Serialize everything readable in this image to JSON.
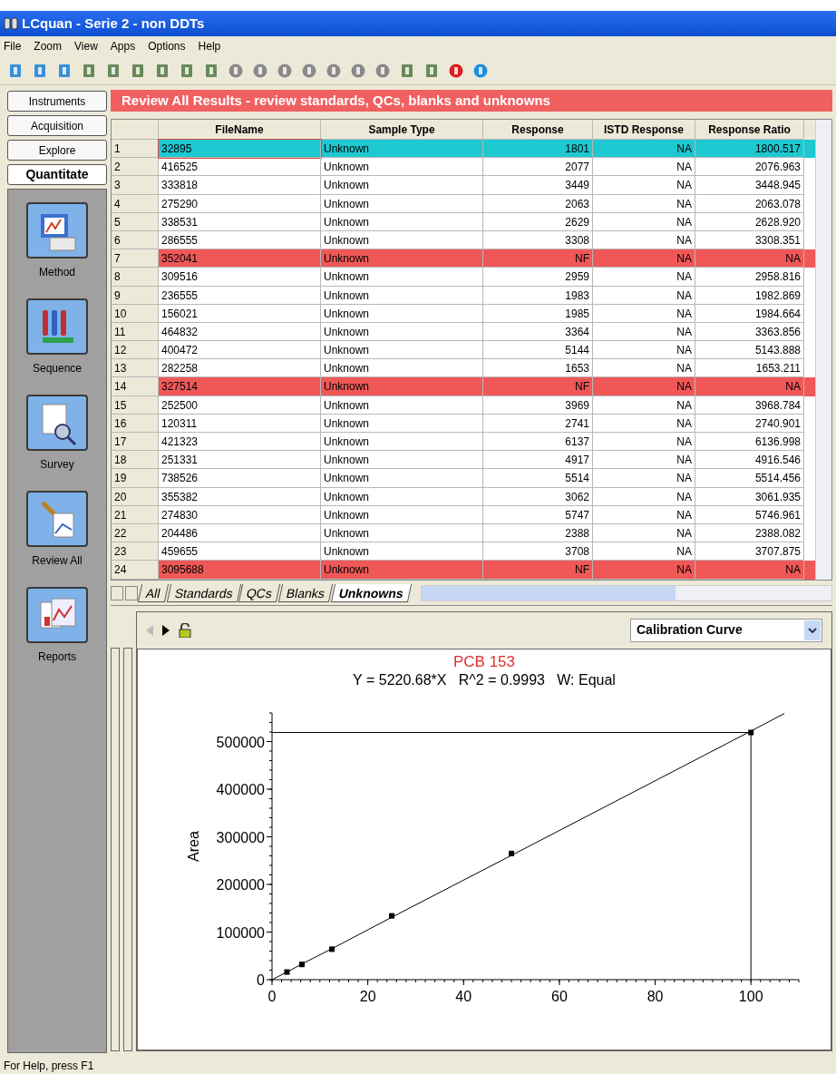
{
  "window": {
    "title": "LCquan - Serie 2 - non DDTs"
  },
  "menu": [
    "File",
    "Zoom",
    "View",
    "Apps",
    "Options",
    "Help"
  ],
  "nav_buttons": [
    {
      "label": "Instruments",
      "selected": false
    },
    {
      "label": "Acquisition",
      "selected": false
    },
    {
      "label": "Explore",
      "selected": false
    },
    {
      "label": "Quantitate",
      "selected": true
    }
  ],
  "sidebar": {
    "items": [
      {
        "label": "Method",
        "kind": "method"
      },
      {
        "label": "Sequence",
        "kind": "sequence"
      },
      {
        "label": "Survey",
        "kind": "survey"
      },
      {
        "label": "Review All",
        "kind": "review"
      },
      {
        "label": "Reports",
        "kind": "reports"
      }
    ]
  },
  "banner": "Review All Results - review standards, QCs, blanks and unknowns",
  "table": {
    "columns": [
      "FileName",
      "Sample Type",
      "Response",
      "ISTD Response",
      "Response Ratio"
    ],
    "rows": [
      {
        "n": "1",
        "file": "32895",
        "type": "Unknown",
        "response": "1801",
        "istd": "NA",
        "ratio": "1800.517",
        "selected": true,
        "flagged": false
      },
      {
        "n": "2",
        "file": "416525",
        "type": "Unknown",
        "response": "2077",
        "istd": "NA",
        "ratio": "2076.963",
        "selected": false,
        "flagged": false
      },
      {
        "n": "3",
        "file": "333818",
        "type": "Unknown",
        "response": "3449",
        "istd": "NA",
        "ratio": "3448.945",
        "selected": false,
        "flagged": false
      },
      {
        "n": "4",
        "file": "275290",
        "type": "Unknown",
        "response": "2063",
        "istd": "NA",
        "ratio": "2063.078",
        "selected": false,
        "flagged": false
      },
      {
        "n": "5",
        "file": "338531",
        "type": "Unknown",
        "response": "2629",
        "istd": "NA",
        "ratio": "2628.920",
        "selected": false,
        "flagged": false
      },
      {
        "n": "6",
        "file": "286555",
        "type": "Unknown",
        "response": "3308",
        "istd": "NA",
        "ratio": "3308.351",
        "selected": false,
        "flagged": false
      },
      {
        "n": "7",
        "file": "352041",
        "type": "Unknown",
        "response": "NF",
        "istd": "NA",
        "ratio": "NA",
        "selected": false,
        "flagged": true
      },
      {
        "n": "8",
        "file": "309516",
        "type": "Unknown",
        "response": "2959",
        "istd": "NA",
        "ratio": "2958.816",
        "selected": false,
        "flagged": false
      },
      {
        "n": "9",
        "file": "236555",
        "type": "Unknown",
        "response": "1983",
        "istd": "NA",
        "ratio": "1982.869",
        "selected": false,
        "flagged": false
      },
      {
        "n": "10",
        "file": "156021",
        "type": "Unknown",
        "response": "1985",
        "istd": "NA",
        "ratio": "1984.664",
        "selected": false,
        "flagged": false
      },
      {
        "n": "11",
        "file": "464832",
        "type": "Unknown",
        "response": "3364",
        "istd": "NA",
        "ratio": "3363.856",
        "selected": false,
        "flagged": false
      },
      {
        "n": "12",
        "file": "400472",
        "type": "Unknown",
        "response": "5144",
        "istd": "NA",
        "ratio": "5143.888",
        "selected": false,
        "flagged": false
      },
      {
        "n": "13",
        "file": "282258",
        "type": "Unknown",
        "response": "1653",
        "istd": "NA",
        "ratio": "1653.211",
        "selected": false,
        "flagged": false
      },
      {
        "n": "14",
        "file": "327514",
        "type": "Unknown",
        "response": "NF",
        "istd": "NA",
        "ratio": "NA",
        "selected": false,
        "flagged": true
      },
      {
        "n": "15",
        "file": "252500",
        "type": "Unknown",
        "response": "3969",
        "istd": "NA",
        "ratio": "3968.784",
        "selected": false,
        "flagged": false
      },
      {
        "n": "16",
        "file": "120311",
        "type": "Unknown",
        "response": "2741",
        "istd": "NA",
        "ratio": "2740.901",
        "selected": false,
        "flagged": false
      },
      {
        "n": "17",
        "file": "421323",
        "type": "Unknown",
        "response": "6137",
        "istd": "NA",
        "ratio": "6136.998",
        "selected": false,
        "flagged": false
      },
      {
        "n": "18",
        "file": "251331",
        "type": "Unknown",
        "response": "4917",
        "istd": "NA",
        "ratio": "4916.546",
        "selected": false,
        "flagged": false
      },
      {
        "n": "19",
        "file": "738526",
        "type": "Unknown",
        "response": "5514",
        "istd": "NA",
        "ratio": "5514.456",
        "selected": false,
        "flagged": false
      },
      {
        "n": "20",
        "file": "355382",
        "type": "Unknown",
        "response": "3062",
        "istd": "NA",
        "ratio": "3061.935",
        "selected": false,
        "flagged": false
      },
      {
        "n": "21",
        "file": "274830",
        "type": "Unknown",
        "response": "5747",
        "istd": "NA",
        "ratio": "5746.961",
        "selected": false,
        "flagged": false
      },
      {
        "n": "22",
        "file": "204486",
        "type": "Unknown",
        "response": "2388",
        "istd": "NA",
        "ratio": "2388.082",
        "selected": false,
        "flagged": false
      },
      {
        "n": "23",
        "file": "459655",
        "type": "Unknown",
        "response": "3708",
        "istd": "NA",
        "ratio": "3707.875",
        "selected": false,
        "flagged": false
      },
      {
        "n": "24",
        "file": "3095688",
        "type": "Unknown",
        "response": "NF",
        "istd": "NA",
        "ratio": "NA",
        "selected": false,
        "flagged": true
      }
    ]
  },
  "sheet_tabs": [
    {
      "label": "All",
      "selected": false
    },
    {
      "label": "Standards",
      "selected": false
    },
    {
      "label": "QCs",
      "selected": false
    },
    {
      "label": "Blanks",
      "selected": false
    },
    {
      "label": "Unknowns",
      "selected": true
    }
  ],
  "chart_panel": {
    "view_select": "Calibration Curve",
    "equation": "Y = 5220.68*X   R^2 = 0.9993   W: Equal",
    "chart_data": {
      "type": "scatter",
      "title": "PCB 153",
      "ylabel": "Area",
      "x": [
        0,
        3.125,
        6.25,
        12.5,
        25,
        50,
        100,
        107
      ],
      "series": [
        {
          "type": "scatter",
          "color": "#000000",
          "values": [
            null,
            16000,
            32000,
            64000,
            134000,
            265000,
            519000,
            null
          ]
        },
        {
          "type": "line",
          "color": "#000000",
          "values": [
            0,
            16000,
            33000,
            65000,
            131000,
            261000,
            522000,
            559000
          ]
        }
      ],
      "ref_lines": [
        {
          "axis": "y",
          "value": 519000
        },
        {
          "axis": "x",
          "value": 100
        }
      ],
      "xlim": [
        0,
        110
      ],
      "ylim": [
        0,
        560000
      ],
      "xticks": [
        0,
        20,
        40,
        60,
        80,
        100
      ],
      "yticks": [
        0,
        100000,
        200000,
        300000,
        400000,
        500000
      ]
    }
  },
  "status_bar": "For Help, press F1"
}
